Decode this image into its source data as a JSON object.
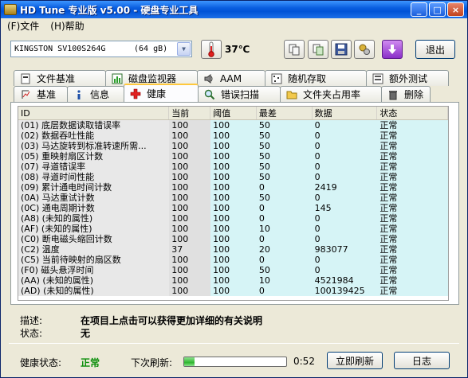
{
  "window": {
    "title": "HD Tune 专业版 v5.00 - 硬盘专业工具",
    "minimize": "_",
    "maximize": "□",
    "close": "×"
  },
  "menu": [
    {
      "label": "(F)文件"
    },
    {
      "label": "(H)帮助"
    }
  ],
  "toolbar": {
    "drive_name": "KINGSTON SV100S264G",
    "drive_size": "(64 gB)",
    "temperature": "37℃",
    "exit_label": "退出"
  },
  "tabs_top": [
    {
      "label": "文件基准",
      "icon": "file-benchmark-icon"
    },
    {
      "label": "磁盘监视器",
      "icon": "disk-monitor-icon"
    },
    {
      "label": "AAM",
      "icon": "speaker-icon"
    },
    {
      "label": "随机存取",
      "icon": "random-access-icon"
    },
    {
      "label": "额外测试",
      "icon": "extra-tests-icon"
    }
  ],
  "tabs_bottom": [
    {
      "label": "基准",
      "icon": "benchmark-icon"
    },
    {
      "label": "信息",
      "icon": "info-icon"
    },
    {
      "label": "健康",
      "icon": "health-cross-icon",
      "active": true
    },
    {
      "label": "错误扫描",
      "icon": "magnifier-icon"
    },
    {
      "label": "文件夹占用率",
      "icon": "folder-icon"
    },
    {
      "label": "删除",
      "icon": "trash-icon"
    }
  ],
  "table": {
    "headers": [
      "ID",
      "当前",
      "阈值",
      "最差",
      "数据",
      "状态"
    ],
    "rows": [
      [
        "(01) 底层数据读取错误率",
        "100",
        "100",
        "50",
        "0",
        "正常"
      ],
      [
        "(02) 数据吞吐性能",
        "100",
        "100",
        "50",
        "0",
        "正常"
      ],
      [
        "(03) 马达旋转到标准转速所需...",
        "100",
        "100",
        "50",
        "0",
        "正常"
      ],
      [
        "(05) 重映射扇区计数",
        "100",
        "100",
        "50",
        "0",
        "正常"
      ],
      [
        "(07) 寻道错误率",
        "100",
        "100",
        "50",
        "0",
        "正常"
      ],
      [
        "(08) 寻道时间性能",
        "100",
        "100",
        "50",
        "0",
        "正常"
      ],
      [
        "(09) 累计通电时间计数",
        "100",
        "100",
        "0",
        "2419",
        "正常"
      ],
      [
        "(0A) 马达重试计数",
        "100",
        "100",
        "50",
        "0",
        "正常"
      ],
      [
        "(0C) 通电周期计数",
        "100",
        "100",
        "0",
        "145",
        "正常"
      ],
      [
        "(A8) (未知的属性)",
        "100",
        "100",
        "0",
        "0",
        "正常"
      ],
      [
        "(AF) (未知的属性)",
        "100",
        "100",
        "10",
        "0",
        "正常"
      ],
      [
        "(C0) 断电磁头缩回计数",
        "100",
        "100",
        "0",
        "0",
        "正常"
      ],
      [
        "(C2) 温度",
        "37",
        "100",
        "20",
        "983077",
        "正常"
      ],
      [
        "(C5) 当前待映射的扇区数",
        "100",
        "100",
        "0",
        "0",
        "正常"
      ],
      [
        "(F0) 磁头悬浮时间",
        "100",
        "100",
        "50",
        "0",
        "正常"
      ],
      [
        "(AA) (未知的属性)",
        "100",
        "100",
        "10",
        "4521984",
        "正常"
      ],
      [
        "(AD) (未知的属性)",
        "100",
        "100",
        "0",
        "100139425",
        "正常"
      ]
    ]
  },
  "description": {
    "label": "描述:",
    "text": "在项目上点击可以获得更加详细的有关说明",
    "state_label": "状态:",
    "state_text": "无"
  },
  "statusbar": {
    "health_label": "健康状态:",
    "health_value": "正常",
    "next_refresh_label": "下次刷新:",
    "refresh_progress": 0.1,
    "countdown": "0:52",
    "refresh_button": "立即刷新",
    "log_button": "日志"
  },
  "colors": {
    "health_ok": "#0c8f0c",
    "title_bar": "#0a5fe0",
    "column_tint": "#d6f4f6"
  }
}
